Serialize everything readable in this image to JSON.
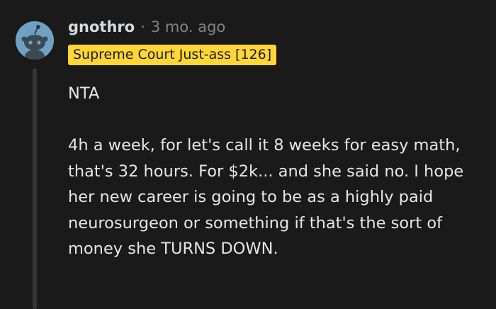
{
  "comment": {
    "author": "gnothro",
    "separator": "·",
    "timestamp": "3 mo. ago",
    "flair": "Supreme Court Just-ass [126]",
    "avatar_icon": "snoo-avatar-icon",
    "paragraphs": [
      "NTA",
      "4h a week, for let's call it 8 weeks for easy math, that's 32 hours. For $2k... and she said no. I hope her new career is going to be as a highly paid neurosurgeon or something if that's the sort of money she TURNS DOWN."
    ]
  },
  "colors": {
    "background": "#1a1a1b",
    "flair_bg": "#ffd635",
    "avatar_bg": "#6fa2c2",
    "meta_text": "#818384",
    "body_text": "#e4e6e8"
  }
}
